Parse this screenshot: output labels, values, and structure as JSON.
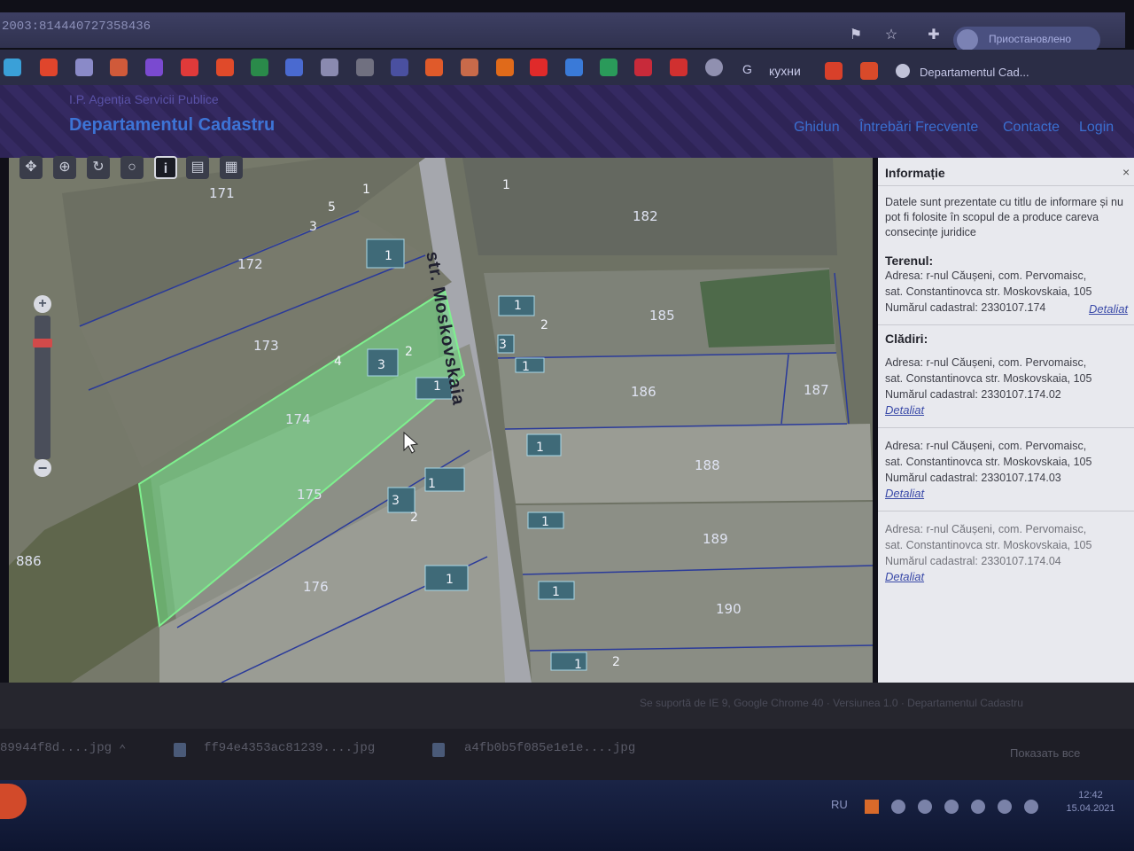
{
  "browser": {
    "url": "2003:814440727358436",
    "profile_label": "Приостановлено",
    "bookmarks": [
      {
        "icon": "bookmark-icon",
        "color": "#3aa0d8"
      },
      {
        "icon": "bookmark-icon",
        "color": "#e0452c"
      },
      {
        "icon": "bookmark-icon",
        "color": "#8a8ac8"
      },
      {
        "icon": "bookmark-icon",
        "color": "#d05a3a"
      },
      {
        "icon": "bookmark-icon",
        "color": "#7a4ad0"
      },
      {
        "icon": "bookmark-icon",
        "color": "#e03a3a"
      },
      {
        "icon": "bookmark-icon",
        "color": "#e04a2a"
      },
      {
        "icon": "bookmark-icon",
        "color": "#2a8a4a"
      },
      {
        "icon": "bookmark-icon",
        "color": "#4a6ad0"
      },
      {
        "icon": "bookmark-icon",
        "color": "#8a8ab0"
      },
      {
        "icon": "bookmark-icon",
        "color": "#707080"
      },
      {
        "icon": "bookmark-icon",
        "color": "#4a50a0"
      },
      {
        "icon": "bookmark-icon",
        "color": "#e05a2a"
      },
      {
        "icon": "bookmark-icon",
        "color": "#c86a4a"
      },
      {
        "icon": "bookmark-icon",
        "color": "#e06a1a"
      },
      {
        "icon": "bookmark-icon",
        "color": "#e02a2a"
      },
      {
        "icon": "mail-icon",
        "color": "#3a7ad8"
      },
      {
        "icon": "m-icon",
        "color": "#2a9a5a"
      },
      {
        "icon": "bookmark-icon",
        "color": "#c82a3a"
      },
      {
        "icon": "bookmark-icon",
        "color": "#d03030"
      },
      {
        "icon": "wordpress-icon",
        "color": "#9090b0"
      }
    ],
    "bookmark_g_label": "G",
    "bookmark_kuhni": "кухни",
    "bookmark_last": "Departamentul Cad..."
  },
  "site": {
    "agency": "I.P. Agenția Servicii Publice",
    "title": "Departamentul Cadastru",
    "nav": [
      "Ghidun",
      "Întrebări Frecvente",
      "Contacte",
      "Login"
    ]
  },
  "map": {
    "street": "str. Moskovskaia",
    "parcels": [
      "171",
      "172",
      "173",
      "174",
      "175",
      "176",
      "182",
      "185",
      "186",
      "187",
      "188",
      "189",
      "190",
      "886"
    ],
    "buildings": [
      "1",
      "2",
      "3",
      "4",
      "5"
    ],
    "tools": [
      "pan-icon",
      "zoom-box-icon",
      "refresh-icon",
      "measure-icon",
      "info-icon",
      "print-icon",
      "layers-icon"
    ],
    "tool_glyphs": [
      "✥",
      "⊕",
      "↻",
      "○",
      "i",
      "▤",
      "▦"
    ],
    "zoom_in": "+",
    "zoom_out": "−",
    "selected_color": "#74e68a"
  },
  "info": {
    "title": "Informație",
    "close": "×",
    "disclaimer": "Datele sunt prezentate cu titlu de informare și nu pot fi folosite în scopul de a produce careva consecințe juridice",
    "teren_heading": "Terenul:",
    "teren": {
      "address_1": "Adresa: r-nul Căușeni, com. Pervomaisc,",
      "address_2": "sat. Constantinovca str. Moskovskaia, 105",
      "cadastral": "Numărul cadastral: 2330107.174",
      "link": "Detaliat"
    },
    "cladiri_heading": "Clădiri:",
    "cladiri": [
      {
        "address_1": "Adresa: r-nul Căușeni, com. Pervomaisc,",
        "address_2": "sat. Constantinovca str. Moskovskaia, 105",
        "cadastral": "Numărul cadastral: 2330107.174.02",
        "link": "Detaliat"
      },
      {
        "address_1": "Adresa: r-nul Căușeni, com. Pervomaisc,",
        "address_2": "sat. Constantinovca str. Moskovskaia, 105",
        "cadastral": "Numărul cadastral: 2330107.174.03",
        "link": "Detaliat"
      },
      {
        "address_1": "Adresa: r-nul Căușeni, com. Pervomaisc,",
        "address_2": "sat. Constantinovca str. Moskovskaia, 105",
        "cadastral": "Numărul cadastral: 2330107.174.04",
        "link": "Detaliat"
      }
    ]
  },
  "footer": {
    "text": "Se suportă de IE 9, Google Chrome 40 · Versiunea 1.0 · Departamentul Cadastru"
  },
  "downloads": {
    "items": [
      "89944f8d....jpg",
      "ff94e4353ac81239....jpg",
      "a4fb0b5f085e1e1e....jpg"
    ],
    "show_all": "Показать все"
  },
  "taskbar": {
    "lang": "RU",
    "time": "12:42",
    "date": "15.04.2021"
  }
}
